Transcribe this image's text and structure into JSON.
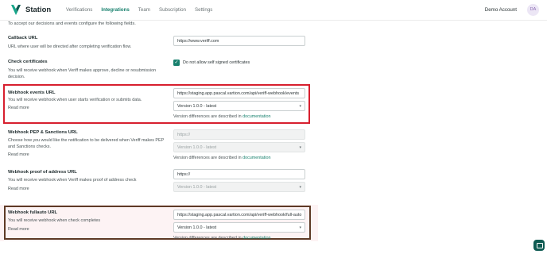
{
  "brand": {
    "name": "Station"
  },
  "nav": {
    "items": [
      "Verifications",
      "Integrations",
      "Team",
      "Subscription",
      "Settings"
    ],
    "active": "Integrations"
  },
  "account": {
    "name": "Demo Account",
    "initials": "DA"
  },
  "intro": "To accept our decisions and events configure the following fields.",
  "callback": {
    "title": "Callback URL",
    "desc": "URL where user will be directed after completing verification flow.",
    "value": "https://www.veriff.com"
  },
  "certificates": {
    "title": "Check certificates",
    "desc": "You will receive webhook when Veriff makes approve, decline or resubmission decision.",
    "checkbox_label": "Do not allow self signed certificates"
  },
  "events": {
    "title": "Webhook events URL",
    "desc": "You will receive webhook when user starts verification or submits data.",
    "read_more": "Read more",
    "value": "https://staging.app.pascal.vartion.com/api/veriff-webhook/events",
    "version": "Version 1.0.0 - latest",
    "note": "Version differences are described in",
    "note_link": "documentation"
  },
  "pep": {
    "title": "Webhook PEP & Sanctions URL",
    "desc": "Choose how you would like the notification to be delivered when Veriff makes PEP and Sanctions checks.",
    "read_more": "Read more",
    "placeholder": "https://",
    "version": "Version 1.0.0 - latest",
    "note": "Version differences are described in",
    "note_link": "documentation"
  },
  "poa": {
    "title": "Webhook proof of address URL",
    "desc": "You will receive webhook when Veriff makes proof of address check",
    "read_more": "Read more",
    "placeholder": "https://",
    "version": "Version 1.0.0 - latest"
  },
  "fullauto": {
    "title": "Webhook fullauto URL",
    "desc": "You will receive webhook when check completes",
    "read_more": "Read more",
    "value": "https://staging.app.pascal.vartion.com/api/veriff-webhook/full-auto",
    "version": "Version 1.0.0 - latest",
    "note": "Version differences are described in",
    "note_link": "documentation"
  },
  "colors": {
    "accent": "#17806d",
    "highlight_red": "#d71f2e",
    "highlight_brown": "#5e3a26"
  },
  "icons": {
    "logo": "veriff-logo-icon",
    "chat": "chat-icon",
    "check": "checkmark-icon",
    "dropdown": "chevron-down-icon"
  }
}
